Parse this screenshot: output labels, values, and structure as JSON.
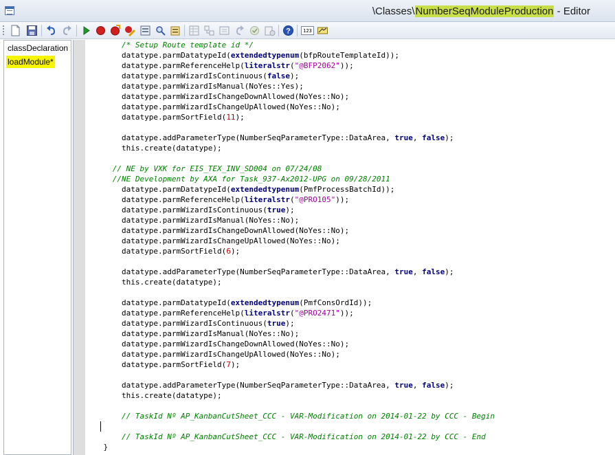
{
  "window": {
    "title_prefix": "\\Classes\\",
    "title_highlight": "NumberSeqModuleProduction",
    "title_suffix": " - Editor"
  },
  "toolbar": {
    "buttons": [
      {
        "name": "new-icon"
      },
      {
        "name": "save-icon"
      },
      {
        "name": "undo-icon"
      },
      {
        "name": "redo-icon"
      },
      {
        "name": "run-icon"
      },
      {
        "name": "breakpoint-icon"
      },
      {
        "name": "toggle-breakpoint-icon"
      },
      {
        "name": "remove-breakpoints-icon"
      },
      {
        "name": "compile-icon"
      },
      {
        "name": "lookup-icon"
      },
      {
        "name": "properties-icon"
      },
      {
        "name": "list-tables-icon"
      },
      {
        "name": "list-classes-icon"
      },
      {
        "name": "list-types-icon"
      },
      {
        "name": "list-enums-icon"
      },
      {
        "name": "labels-icon"
      },
      {
        "name": "scripts-icon"
      },
      {
        "name": "help-icon"
      },
      {
        "name": "line-number-icon"
      },
      {
        "name": "settings-icon"
      }
    ],
    "line_number_label": "123"
  },
  "sidebar": {
    "items": [
      {
        "label": "classDeclaration",
        "active": false
      },
      {
        "label": "loadModule*",
        "active": true
      }
    ]
  },
  "editor": {
    "lines": [
      [
        {
          "t": "c",
          "v": "        /* Setup Route template id */"
        }
      ],
      [
        {
          "t": "p",
          "v": "        datatype.parmDatatypeId("
        },
        {
          "t": "k",
          "v": "extendedtypenum"
        },
        {
          "t": "p",
          "v": "(bfpRouteTemplateId));"
        }
      ],
      [
        {
          "t": "p",
          "v": "        datatype.parmReferenceHelp("
        },
        {
          "t": "k",
          "v": "literalstr"
        },
        {
          "t": "p",
          "v": "("
        },
        {
          "t": "s",
          "v": "\"@BFP2062\""
        },
        {
          "t": "p",
          "v": "));"
        }
      ],
      [
        {
          "t": "p",
          "v": "        datatype.parmWizardIsContinuous("
        },
        {
          "t": "k",
          "v": "false"
        },
        {
          "t": "p",
          "v": ");"
        }
      ],
      [
        {
          "t": "p",
          "v": "        datatype.parmWizardIsManual(NoYes::Yes);"
        }
      ],
      [
        {
          "t": "p",
          "v": "        datatype.parmWizardIsChangeDownAllowed(NoYes::No);"
        }
      ],
      [
        {
          "t": "p",
          "v": "        datatype.parmWizardIsChangeUpAllowed(NoYes::No);"
        }
      ],
      [
        {
          "t": "p",
          "v": "        datatype.parmSortField("
        },
        {
          "t": "n",
          "v": "11"
        },
        {
          "t": "p",
          "v": ");"
        }
      ],
      [],
      [
        {
          "t": "p",
          "v": "        datatype.addParameterType(NumberSeqParameterType::DataArea, "
        },
        {
          "t": "k",
          "v": "true"
        },
        {
          "t": "p",
          "v": ", "
        },
        {
          "t": "k",
          "v": "false"
        },
        {
          "t": "p",
          "v": ");"
        }
      ],
      [
        {
          "t": "p",
          "v": "        this.create(datatype);"
        }
      ],
      [],
      [
        {
          "t": "c",
          "v": "      // NE by VXK for EIS_TEX_INV_SD004 on 07/24/08"
        }
      ],
      [
        {
          "t": "c",
          "v": "      //NE Development by AXA for Task_937-Ax2012-UPG on 09/28/2011"
        }
      ],
      [
        {
          "t": "p",
          "v": "        datatype.parmDatatypeId("
        },
        {
          "t": "k",
          "v": "extendedtypenum"
        },
        {
          "t": "p",
          "v": "(PmfProcessBatchId));"
        }
      ],
      [
        {
          "t": "p",
          "v": "        datatype.parmReferenceHelp("
        },
        {
          "t": "k",
          "v": "literalstr"
        },
        {
          "t": "p",
          "v": "("
        },
        {
          "t": "s",
          "v": "\"@PRO105\""
        },
        {
          "t": "p",
          "v": "));"
        }
      ],
      [
        {
          "t": "p",
          "v": "        datatype.parmWizardIsContinuous("
        },
        {
          "t": "k",
          "v": "true"
        },
        {
          "t": "p",
          "v": ");"
        }
      ],
      [
        {
          "t": "p",
          "v": "        datatype.parmWizardIsManual(NoYes::No);"
        }
      ],
      [
        {
          "t": "p",
          "v": "        datatype.parmWizardIsChangeDownAllowed(NoYes::No);"
        }
      ],
      [
        {
          "t": "p",
          "v": "        datatype.parmWizardIsChangeUpAllowed(NoYes::No);"
        }
      ],
      [
        {
          "t": "p",
          "v": "        datatype.parmSortField("
        },
        {
          "t": "n",
          "v": "6"
        },
        {
          "t": "p",
          "v": ");"
        }
      ],
      [],
      [
        {
          "t": "p",
          "v": "        datatype.addParameterType(NumberSeqParameterType::DataArea, "
        },
        {
          "t": "k",
          "v": "true"
        },
        {
          "t": "p",
          "v": ", "
        },
        {
          "t": "k",
          "v": "false"
        },
        {
          "t": "p",
          "v": ");"
        }
      ],
      [
        {
          "t": "p",
          "v": "        this.create(datatype);"
        }
      ],
      [],
      [
        {
          "t": "p",
          "v": "        datatype.parmDatatypeId("
        },
        {
          "t": "k",
          "v": "extendedtypenum"
        },
        {
          "t": "p",
          "v": "(PmfConsOrdId));"
        }
      ],
      [
        {
          "t": "p",
          "v": "        datatype.parmReferenceHelp("
        },
        {
          "t": "k",
          "v": "literalstr"
        },
        {
          "t": "p",
          "v": "("
        },
        {
          "t": "s",
          "v": "\"@PRO2471\""
        },
        {
          "t": "p",
          "v": "));"
        }
      ],
      [
        {
          "t": "p",
          "v": "        datatype.parmWizardIsContinuous("
        },
        {
          "t": "k",
          "v": "true"
        },
        {
          "t": "p",
          "v": ");"
        }
      ],
      [
        {
          "t": "p",
          "v": "        datatype.parmWizardIsManual(NoYes::No);"
        }
      ],
      [
        {
          "t": "p",
          "v": "        datatype.parmWizardIsChangeDownAllowed(NoYes::No);"
        }
      ],
      [
        {
          "t": "p",
          "v": "        datatype.parmWizardIsChangeUpAllowed(NoYes::No);"
        }
      ],
      [
        {
          "t": "p",
          "v": "        datatype.parmSortField("
        },
        {
          "t": "n",
          "v": "7"
        },
        {
          "t": "p",
          "v": ");"
        }
      ],
      [],
      [
        {
          "t": "p",
          "v": "        datatype.addParameterType(NumberSeqParameterType::DataArea, "
        },
        {
          "t": "k",
          "v": "true"
        },
        {
          "t": "p",
          "v": ", "
        },
        {
          "t": "k",
          "v": "false"
        },
        {
          "t": "p",
          "v": ");"
        }
      ],
      [
        {
          "t": "p",
          "v": "        this.create(datatype);"
        }
      ],
      [],
      [
        {
          "t": "c",
          "v": "        // TaskId Nº AP_KanbanCutSheet_CCC - VAR-Modification on 2014-01-22 by CCC - Begin"
        }
      ],
      [],
      [
        {
          "t": "c",
          "v": "        // TaskId Nº AP_KanbanCutSheet_CCC - VAR-Modification on 2014-01-22 by CCC - End"
        }
      ],
      [
        {
          "t": "p",
          "v": "    }"
        }
      ]
    ]
  },
  "colors": {
    "comment": "#008000",
    "keyword": "#00007f",
    "string": "#a000a0",
    "number": "#c00000",
    "highlight": "#c9df4a",
    "active_method": "#f7f500"
  }
}
